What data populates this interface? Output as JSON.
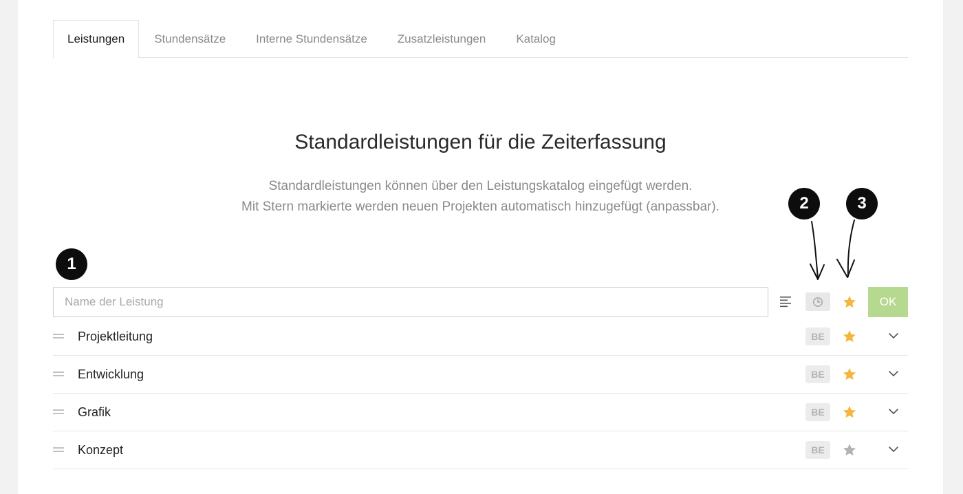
{
  "tabs": [
    {
      "label": "Leistungen",
      "active": true
    },
    {
      "label": "Stundensätze",
      "active": false
    },
    {
      "label": "Interne Stundensätze",
      "active": false
    },
    {
      "label": "Zusatzleistungen",
      "active": false
    },
    {
      "label": "Katalog",
      "active": false
    }
  ],
  "heading": "Standardleistungen für die Zeiterfassung",
  "description": {
    "line1": "Standardleistungen können über den Leistungskatalog eingefügt werden.",
    "line2": "Mit Stern markierte werden neuen Projekten automatisch hinzugefügt (anpassbar)."
  },
  "annotations": {
    "one": "1",
    "two": "2",
    "three": "3"
  },
  "new_entry": {
    "placeholder": "Name der Leistung",
    "value": "",
    "ok_label": "OK",
    "icons": [
      "align-left-icon",
      "clock-icon",
      "star-icon"
    ]
  },
  "services": [
    {
      "label": "Projektleitung",
      "badge": "BE",
      "starred": true
    },
    {
      "label": "Entwicklung",
      "badge": "BE",
      "starred": true
    },
    {
      "label": "Grafik",
      "badge": "BE",
      "starred": true
    },
    {
      "label": "Konzept",
      "badge": "BE",
      "starred": false
    }
  ],
  "colors": {
    "star_active": "#f5b63f",
    "star_inactive": "#b3b3b3",
    "ok_button": "#b5d98f",
    "badge_bg": "#0d0d0d"
  }
}
